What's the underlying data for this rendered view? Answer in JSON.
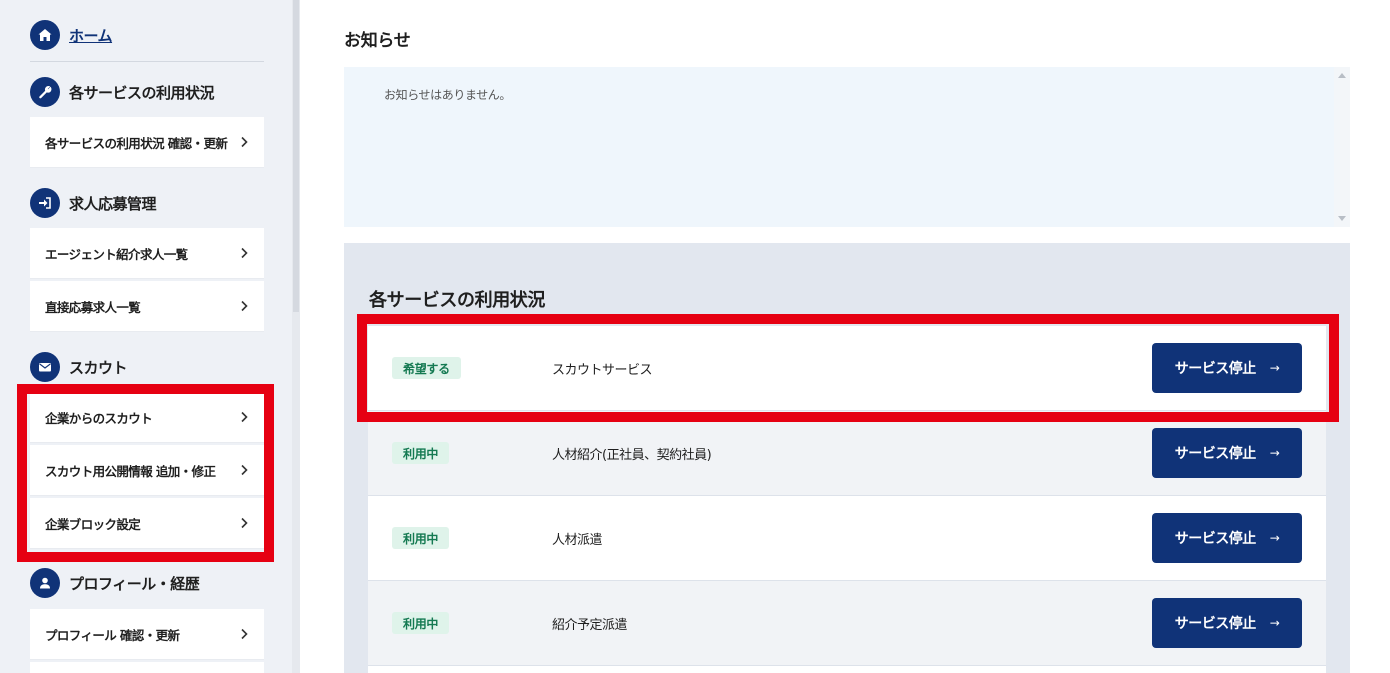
{
  "sidebar": {
    "home": {
      "label": "ホーム",
      "icon": "home-icon"
    },
    "sections": [
      {
        "label": "各サービスの利用状況",
        "icon": "wrench-icon",
        "items": [
          {
            "label": "各サービスの利用状況 確認・更新"
          }
        ]
      },
      {
        "label": "求人応募管理",
        "icon": "sign-in-icon",
        "items": [
          {
            "label": "エージェント紹介求人一覧"
          },
          {
            "label": "直接応募求人一覧"
          }
        ]
      },
      {
        "label": "スカウト",
        "icon": "envelope-icon",
        "items": [
          {
            "label": "企業からのスカウト"
          },
          {
            "label": "スカウト用公開情報 追加・修正"
          },
          {
            "label": "企業ブロック設定"
          }
        ]
      },
      {
        "label": "プロフィール・経歴",
        "icon": "user-icon",
        "items": [
          {
            "label": "プロフィール 確認・更新"
          }
        ]
      }
    ]
  },
  "main": {
    "title": "お知らせ",
    "notice_text": "お知らせはありません。",
    "status_title": "各サービスの利用状況",
    "rows": [
      {
        "badge": "希望する",
        "name": "スカウトサービス",
        "button": "サービス停止"
      },
      {
        "badge": "利用中",
        "name": "人材紹介(正社員、契約社員)",
        "button": "サービス停止"
      },
      {
        "badge": "利用中",
        "name": "人材派遣",
        "button": "サービス停止"
      },
      {
        "badge": "利用中",
        "name": "紹介予定派遣",
        "button": "サービス停止"
      }
    ],
    "button_arrow": "→"
  },
  "colors": {
    "brand": "#103378",
    "highlight": "#e60012",
    "badge_bg": "#dff3ea",
    "badge_text": "#157a52",
    "sidebar_bg": "#eef1f6"
  }
}
